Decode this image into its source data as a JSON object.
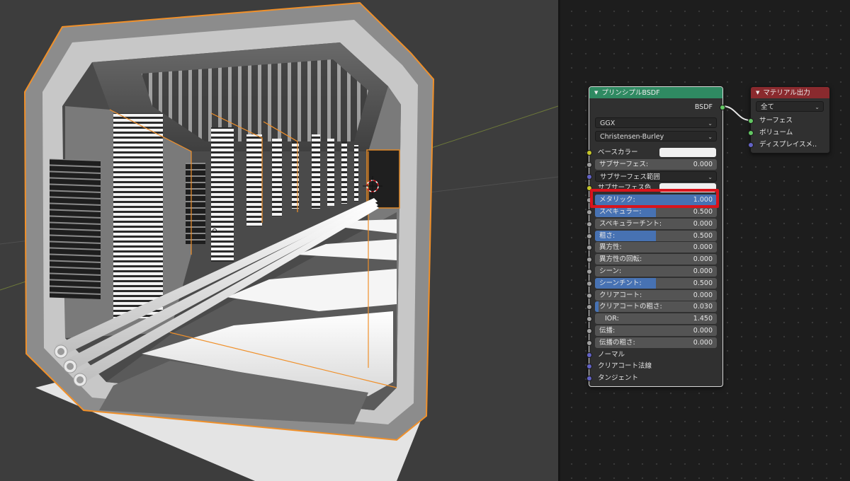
{
  "bsdf_node": {
    "title": "プリンシプルBSDF",
    "output_label": "BSDF",
    "distribution": "GGX",
    "subsurface_method": "Christensen-Burley",
    "inputs": [
      {
        "label": "ベースカラー",
        "kind": "color",
        "color": "#f0f0f0",
        "socket": "yellow"
      },
      {
        "label": "サブサーフェス:",
        "value": "0.000",
        "fill": 0.0,
        "socket": "grey"
      },
      {
        "label": "サブサーフェス範囲",
        "kind": "dropdown",
        "socket": "purple"
      },
      {
        "label": "サブサーフェス色",
        "kind": "color",
        "color": "#f0f0f0",
        "socket": "yellow"
      },
      {
        "label": "メタリック:",
        "value": "1.000",
        "fill": 1.0,
        "socket": "grey"
      },
      {
        "label": "スペキュラー:",
        "value": "0.500",
        "fill": 0.5,
        "socket": "grey"
      },
      {
        "label": "スペキュラーチント:",
        "value": "0.000",
        "fill": 0.0,
        "socket": "grey"
      },
      {
        "label": "粗さ:",
        "value": "0.500",
        "fill": 0.5,
        "socket": "grey"
      },
      {
        "label": "異方性:",
        "value": "0.000",
        "fill": 0.0,
        "socket": "grey"
      },
      {
        "label": "異方性の回転:",
        "value": "0.000",
        "fill": 0.0,
        "socket": "grey"
      },
      {
        "label": "シーン:",
        "value": "0.000",
        "fill": 0.0,
        "socket": "grey"
      },
      {
        "label": "シーンチント:",
        "value": "0.500",
        "fill": 0.5,
        "socket": "grey"
      },
      {
        "label": "クリアコート:",
        "value": "0.000",
        "fill": 0.0,
        "socket": "grey"
      },
      {
        "label": "クリアコートの粗さ:",
        "value": "0.030",
        "fill": 0.03,
        "socket": "grey"
      },
      {
        "label": "IOR:",
        "value": "1.450",
        "fill": 0.0,
        "socket": "grey",
        "centered": true
      },
      {
        "label": "伝播:",
        "value": "0.000",
        "fill": 0.0,
        "socket": "grey"
      },
      {
        "label": "伝播の粗さ:",
        "value": "0.000",
        "fill": 0.0,
        "socket": "grey"
      },
      {
        "label": "ノーマル",
        "kind": "vector",
        "socket": "purple"
      },
      {
        "label": "クリアコート法線",
        "kind": "vector",
        "socket": "purple"
      },
      {
        "label": "タンジェント",
        "kind": "vector",
        "socket": "purple"
      }
    ]
  },
  "output_node": {
    "title": "マテリアル出力",
    "target": "全て",
    "inputs": [
      "サーフェス",
      "ボリューム",
      "ディスプレイスメ.."
    ]
  },
  "colors": {
    "bsdf_header": "#2f8a62",
    "output_header": "#8a2a2e",
    "slider_fill": "#4772b3",
    "highlight_box": "#d9141c",
    "selection_outline": "#f0902a"
  },
  "icons": [
    "collapse-triangle-icon",
    "dropdown-chevron-icon",
    "3d-cursor-icon",
    "origin-dot-icon"
  ]
}
